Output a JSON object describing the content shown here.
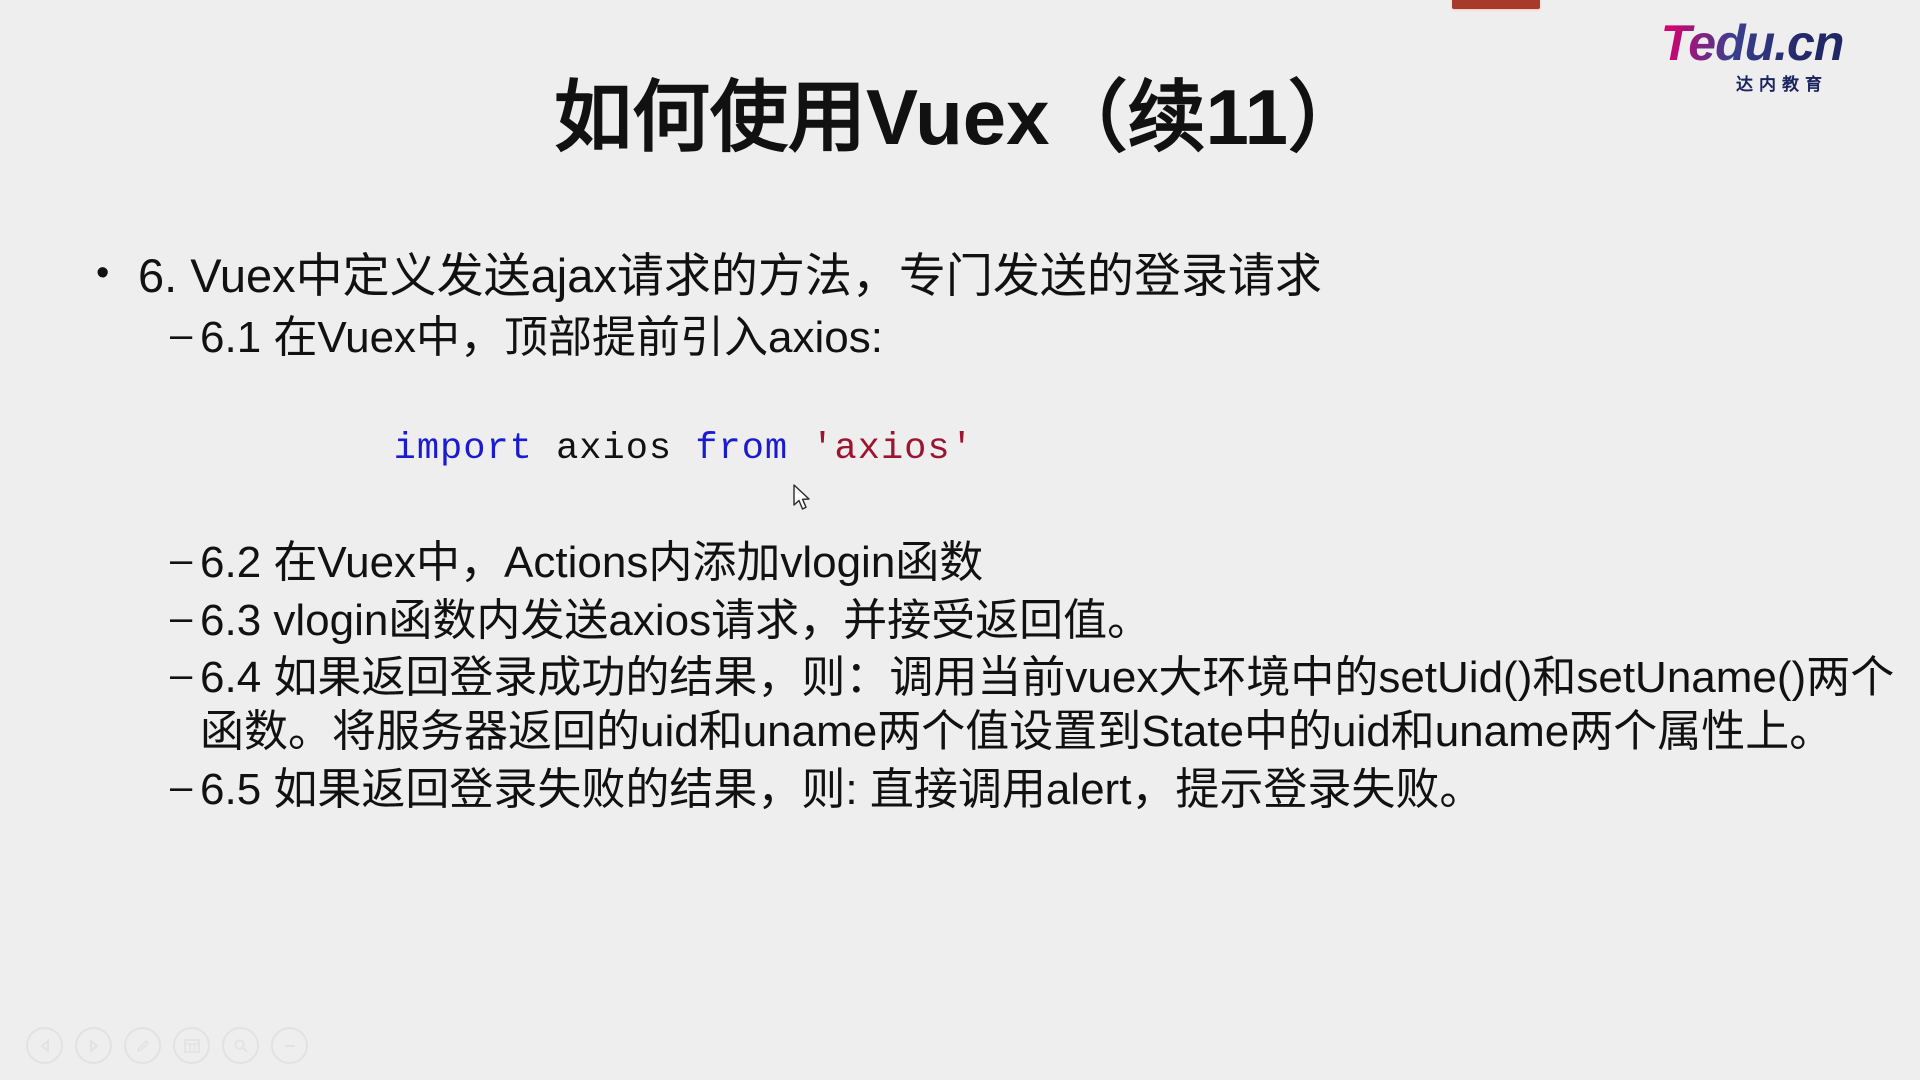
{
  "slide": {
    "title": "如何使用Vuex（续11）",
    "background_color": "#eeeeee",
    "text_color": "#111111"
  },
  "logo": {
    "brand": "Tedu.cn",
    "subtitle": "达内教育",
    "brand_color": "#e3007f",
    "subtitle_color": "#1b2460"
  },
  "top_bar": {
    "color": "#a83a2c"
  },
  "content": {
    "level1": {
      "marker": "•",
      "text": "6. Vuex中定义发送ajax请求的方法，专门发送的登录请求"
    },
    "level2": [
      {
        "marker": "–",
        "text": "6.1 在Vuex中，顶部提前引入axios:"
      },
      {
        "marker": "–",
        "text": "6.2 在Vuex中，Actions内添加vlogin函数"
      },
      {
        "marker": "–",
        "text": "6.3 vlogin函数内发送axios请求，并接受返回值。"
      },
      {
        "marker": "–",
        "text": "6.4 如果返回登录成功的结果，则：调用当前vuex大环境中的setUid()和setUname()两个函数。将服务器返回的uid和uname两个值设置到State中的uid和uname两个属性上。"
      },
      {
        "marker": "–",
        "text": "6.5 如果返回登录失败的结果，则: 直接调用alert，提示登录失败。"
      }
    ],
    "code": {
      "keyword_import": "import",
      "identifier_axios": " axios ",
      "keyword_from": "from",
      "string_axios": " 'axios'",
      "keyword_color": "#1a1ad0",
      "string_color": "#9b1430",
      "identifier_color": "#111111"
    }
  },
  "toolbar": {
    "icons": [
      {
        "name": "previous-slide-icon",
        "glyph": "◀"
      },
      {
        "name": "next-slide-icon",
        "glyph": "▶"
      },
      {
        "name": "pen-icon",
        "glyph": "✎"
      },
      {
        "name": "slide-grid-icon",
        "glyph": "▦"
      },
      {
        "name": "zoom-icon",
        "glyph": "⚲"
      },
      {
        "name": "more-options-icon",
        "glyph": "⋯"
      }
    ]
  }
}
